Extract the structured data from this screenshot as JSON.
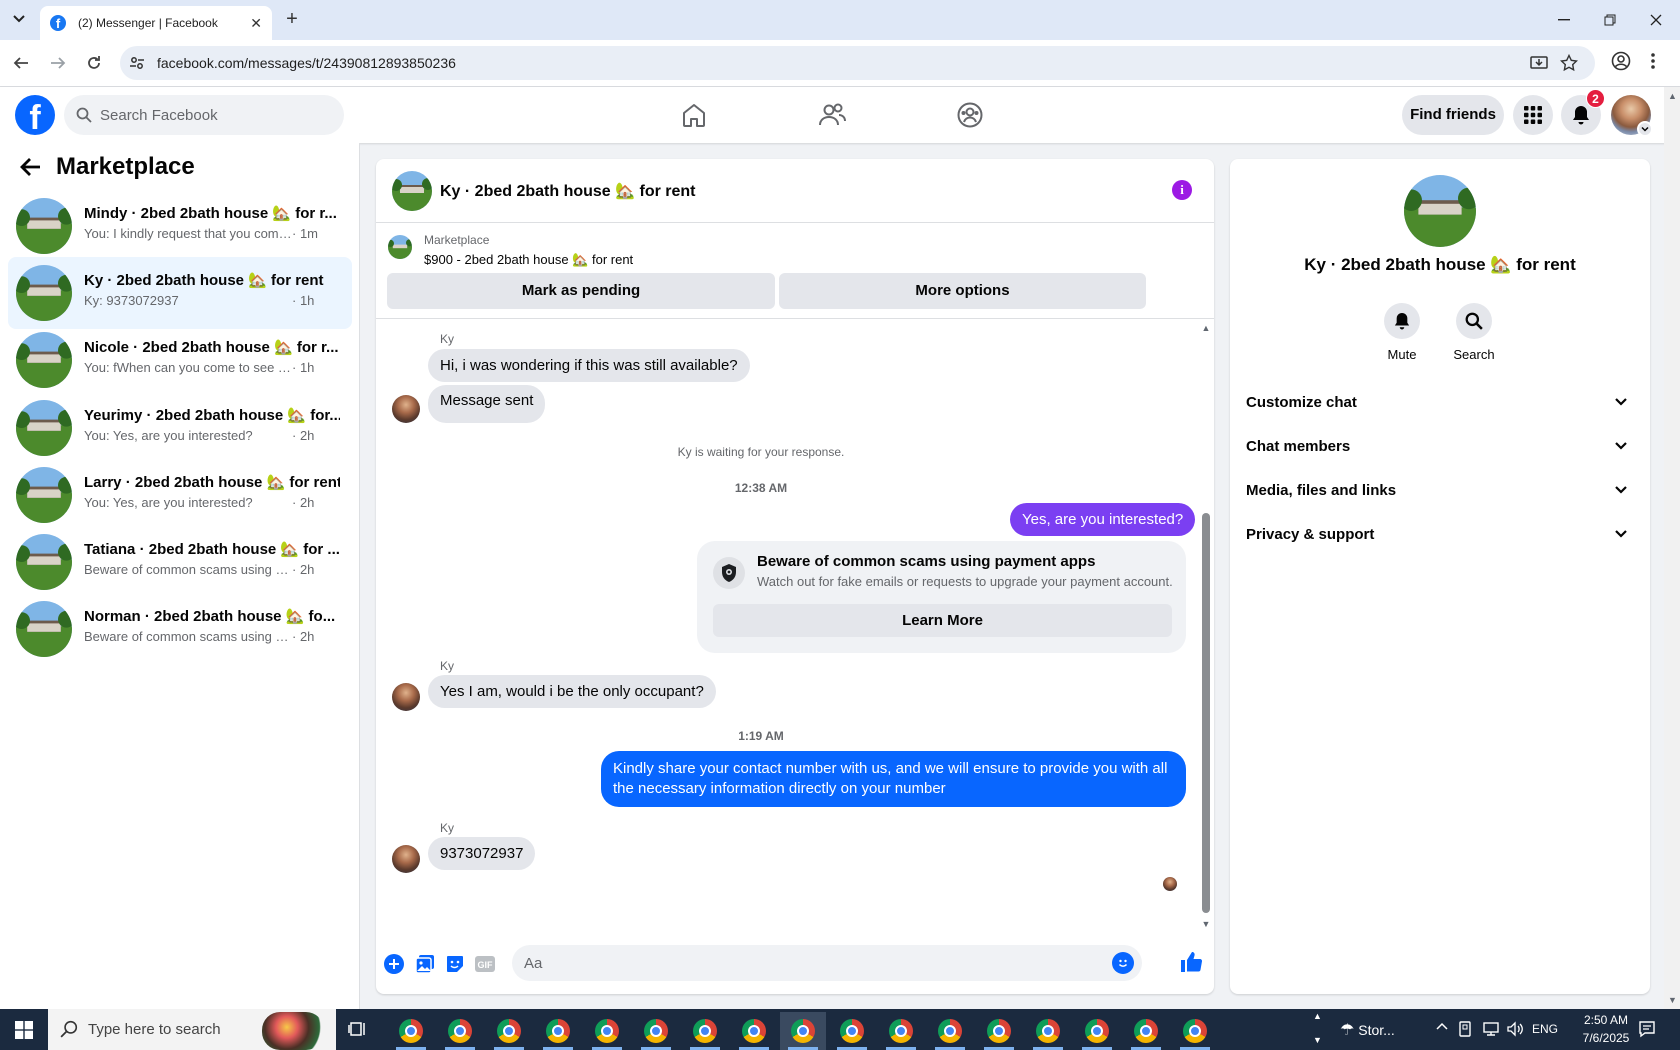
{
  "browser": {
    "tab_title": "(2) Messenger | Facebook",
    "url": "facebook.com/messages/t/24390812893850236"
  },
  "facebook": {
    "search_placeholder": "Search Facebook",
    "find_friends": "Find friends",
    "notification_count": "2"
  },
  "sidebar": {
    "title": "Marketplace",
    "conversations": [
      {
        "name": "Mindy · 2bed 2bath house 🏡 for r...",
        "preview": "You: I kindly request that you comple...",
        "time": "· 1m",
        "active": false
      },
      {
        "name": "Ky · 2bed 2bath house 🏡 for rent",
        "preview": "Ky: 9373072937",
        "time": "· 1h",
        "active": true
      },
      {
        "name": "Nicole · 2bed 2bath house 🏡 for r...",
        "preview": "You: fWhen can you come to see the ...",
        "time": "· 1h",
        "active": false
      },
      {
        "name": "Yeurimy · 2bed 2bath house 🏡 for...",
        "preview": "You: Yes, are you interested?",
        "time": "· 2h",
        "active": false
      },
      {
        "name": "Larry · 2bed 2bath house 🏡 for rent",
        "preview": "You: Yes, are you interested?",
        "time": "· 2h",
        "active": false
      },
      {
        "name": "Tatiana · 2bed 2bath house 🏡 for ...",
        "preview": "Beware of common scams using pay...",
        "time": "· 2h",
        "active": false
      },
      {
        "name": "Norman · 2bed 2bath house 🏡 fo...",
        "preview": "Beware of common scams using pay...",
        "time": "· 2h",
        "active": false
      }
    ]
  },
  "chat": {
    "title": "Ky · 2bed 2bath house 🏡 for rent",
    "listing": {
      "source": "Marketplace",
      "title": "$900 - 2bed 2bath house 🏡 for rent",
      "mark_pending": "Mark as pending",
      "more_options": "More options"
    },
    "sender_name": "Ky",
    "msg_1": "Hi, i was wondering if this was still available?",
    "msg_2": "Message sent",
    "waiting_notice": "Ky is waiting for your response.",
    "time_1": "12:38 AM",
    "msg_3": "Yes, are you interested?",
    "scam_card": {
      "title": "Beware of common scams using payment apps",
      "body": "Watch out for fake emails or requests to upgrade your payment account.",
      "button": "Learn More"
    },
    "msg_4": "Yes I am, would i be the only occupant?",
    "time_2": "1:19 AM",
    "msg_5": "Kindly share your contact number with us, and we will ensure to provide you with all the necessary information directly on your number",
    "msg_6": "9373072937",
    "input_placeholder": "Aa",
    "colors": {
      "outgoing_purple": "#7b3ff2",
      "outgoing_blue": "#0866ff",
      "incoming": "#e4e6eb"
    }
  },
  "details": {
    "name": "Ky · 2bed 2bath house 🏡 for rent",
    "mute": "Mute",
    "search": "Search",
    "sections": [
      "Customize chat",
      "Chat members",
      "Media, files and links",
      "Privacy & support"
    ]
  },
  "taskbar": {
    "search_placeholder": "Type here to search",
    "weather": "Stor...",
    "language": "ENG",
    "time": "2:50 AM",
    "date": "7/6/2025"
  }
}
